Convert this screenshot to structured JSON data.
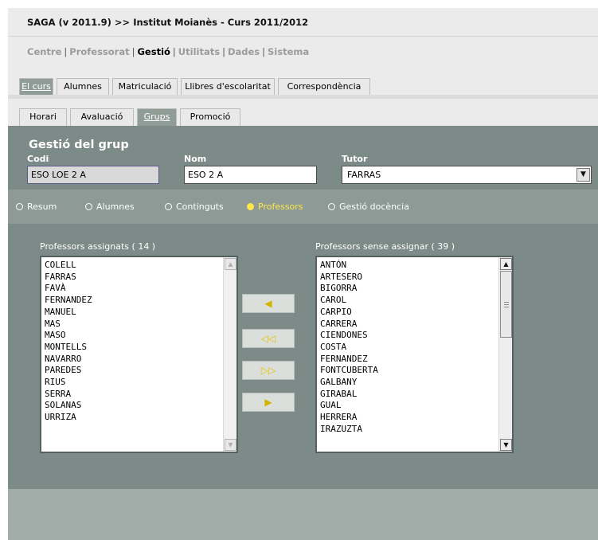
{
  "app": {
    "title": "SAGA (v 2011.9) >> Institut Moianès - Curs 2011/2012"
  },
  "top_menu": {
    "items": [
      "Centre",
      "Professorat",
      "Gestió",
      "Utilitats",
      "Dades",
      "Sistema"
    ],
    "current": "Gestió",
    "separator": "|"
  },
  "tabs_level1": [
    "El curs",
    "Alumnes",
    "Matriculació",
    "Llibres d'escolaritat",
    "Correspondència"
  ],
  "tabs_level1_active": "El curs",
  "tabs_level2": [
    "Horari",
    "Avaluació",
    "Grups",
    "Promoció"
  ],
  "tabs_level2_active": "Grups",
  "group": {
    "title": "Gestió del grup",
    "codi_label": "Codi",
    "codi_value": "ESO LOE 2 A",
    "nom_label": "Nom",
    "nom_value": "ESO 2 A",
    "tutor_label": "Tutor",
    "tutor_value": "FARRAS"
  },
  "subnav": {
    "options": [
      "Resum",
      "Alumnes",
      "Continguts",
      "Professors",
      "Gestió docència"
    ],
    "selected": "Professors"
  },
  "assigned": {
    "label": "Professors assignats ( 14 )",
    "items": [
      "COLELL",
      "FARRAS",
      "FAVÀ",
      "FERNANDEZ",
      "MANUEL",
      "MAS",
      "MASO",
      "MONTELLS",
      "NAVARRO",
      "PAREDES",
      "RIUS",
      "SERRA",
      "SOLANAS",
      "URRIZA"
    ]
  },
  "unassigned": {
    "label": "Professors sense assignar ( 39 )",
    "items": [
      "ANTÓN",
      "ARTESERO",
      "BIGORRA",
      "CAROL",
      "CARPIO",
      "CARRERA",
      "CIENDONES",
      "COSTA",
      "FERNANDEZ",
      "FONTCUBERTA",
      "GALBANY",
      "GIRABAL",
      "GUAL",
      "HERRERA",
      "IRAZUZTA"
    ]
  },
  "move_buttons": {
    "move_left": "◀",
    "move_all_left": "◁◁",
    "move_all_right": "▷▷",
    "move_right": "▶"
  },
  "icons": {
    "scroll_up": "▲",
    "scroll_down": "▼",
    "dropdown": "▼"
  },
  "colors": {
    "panel": "#7c8b87",
    "subnav": "#8d9a96",
    "active_tab": "#909d97",
    "selected_option": "#ffe84a"
  }
}
